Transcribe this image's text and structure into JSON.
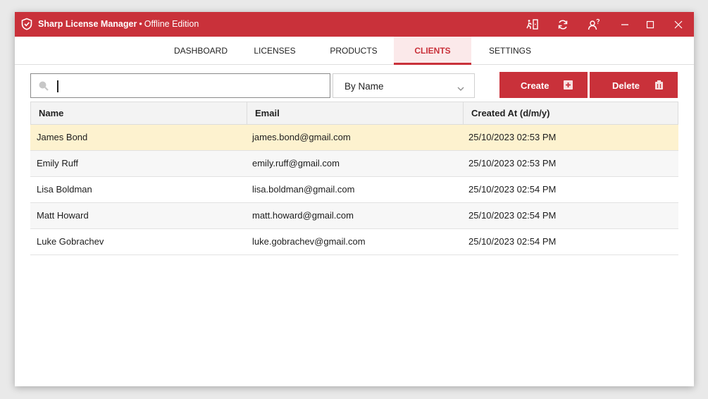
{
  "window": {
    "app_name": "Sharp License Manager",
    "separator": "•",
    "edition": "Offline Edition"
  },
  "colors": {
    "accent": "#c9313a",
    "selected_row": "#fdf2cf",
    "active_tab_bg": "#fbe9ea"
  },
  "icons": {
    "logo": "shield-check-icon",
    "exit": "exit-icon",
    "refresh": "refresh-icon",
    "user_help": "user-help-icon",
    "minimize": "minimize-icon",
    "maximize": "maximize-icon",
    "close": "close-icon"
  },
  "nav": {
    "tabs": [
      {
        "label": "DASHBOARD"
      },
      {
        "label": "LICENSES"
      },
      {
        "label": "PRODUCTS"
      },
      {
        "label": "CLIENTS"
      },
      {
        "label": "SETTINGS"
      }
    ],
    "active": "CLIENTS"
  },
  "search": {
    "value": "",
    "placeholder": ""
  },
  "sort": {
    "selected": "By Name"
  },
  "actions": {
    "create_label": "Create",
    "delete_label": "Delete"
  },
  "table": {
    "headers": [
      "Name",
      "Email",
      "Created At (d/m/y)"
    ],
    "rows": [
      {
        "name": "James Bond",
        "email": "james.bond@gmail.com",
        "created": "25/10/2023 02:53 PM",
        "selected": true
      },
      {
        "name": "Emily Ruff",
        "email": "emily.ruff@gmail.com",
        "created": "25/10/2023 02:53 PM"
      },
      {
        "name": "Lisa Boldman",
        "email": "lisa.boldman@gmail.com",
        "created": "25/10/2023 02:54 PM"
      },
      {
        "name": "Matt Howard",
        "email": "matt.howard@gmail.com",
        "created": "25/10/2023 02:54 PM"
      },
      {
        "name": "Luke Gobrachev",
        "email": "luke.gobrachev@gmail.com",
        "created": "25/10/2023 02:54 PM"
      }
    ]
  }
}
